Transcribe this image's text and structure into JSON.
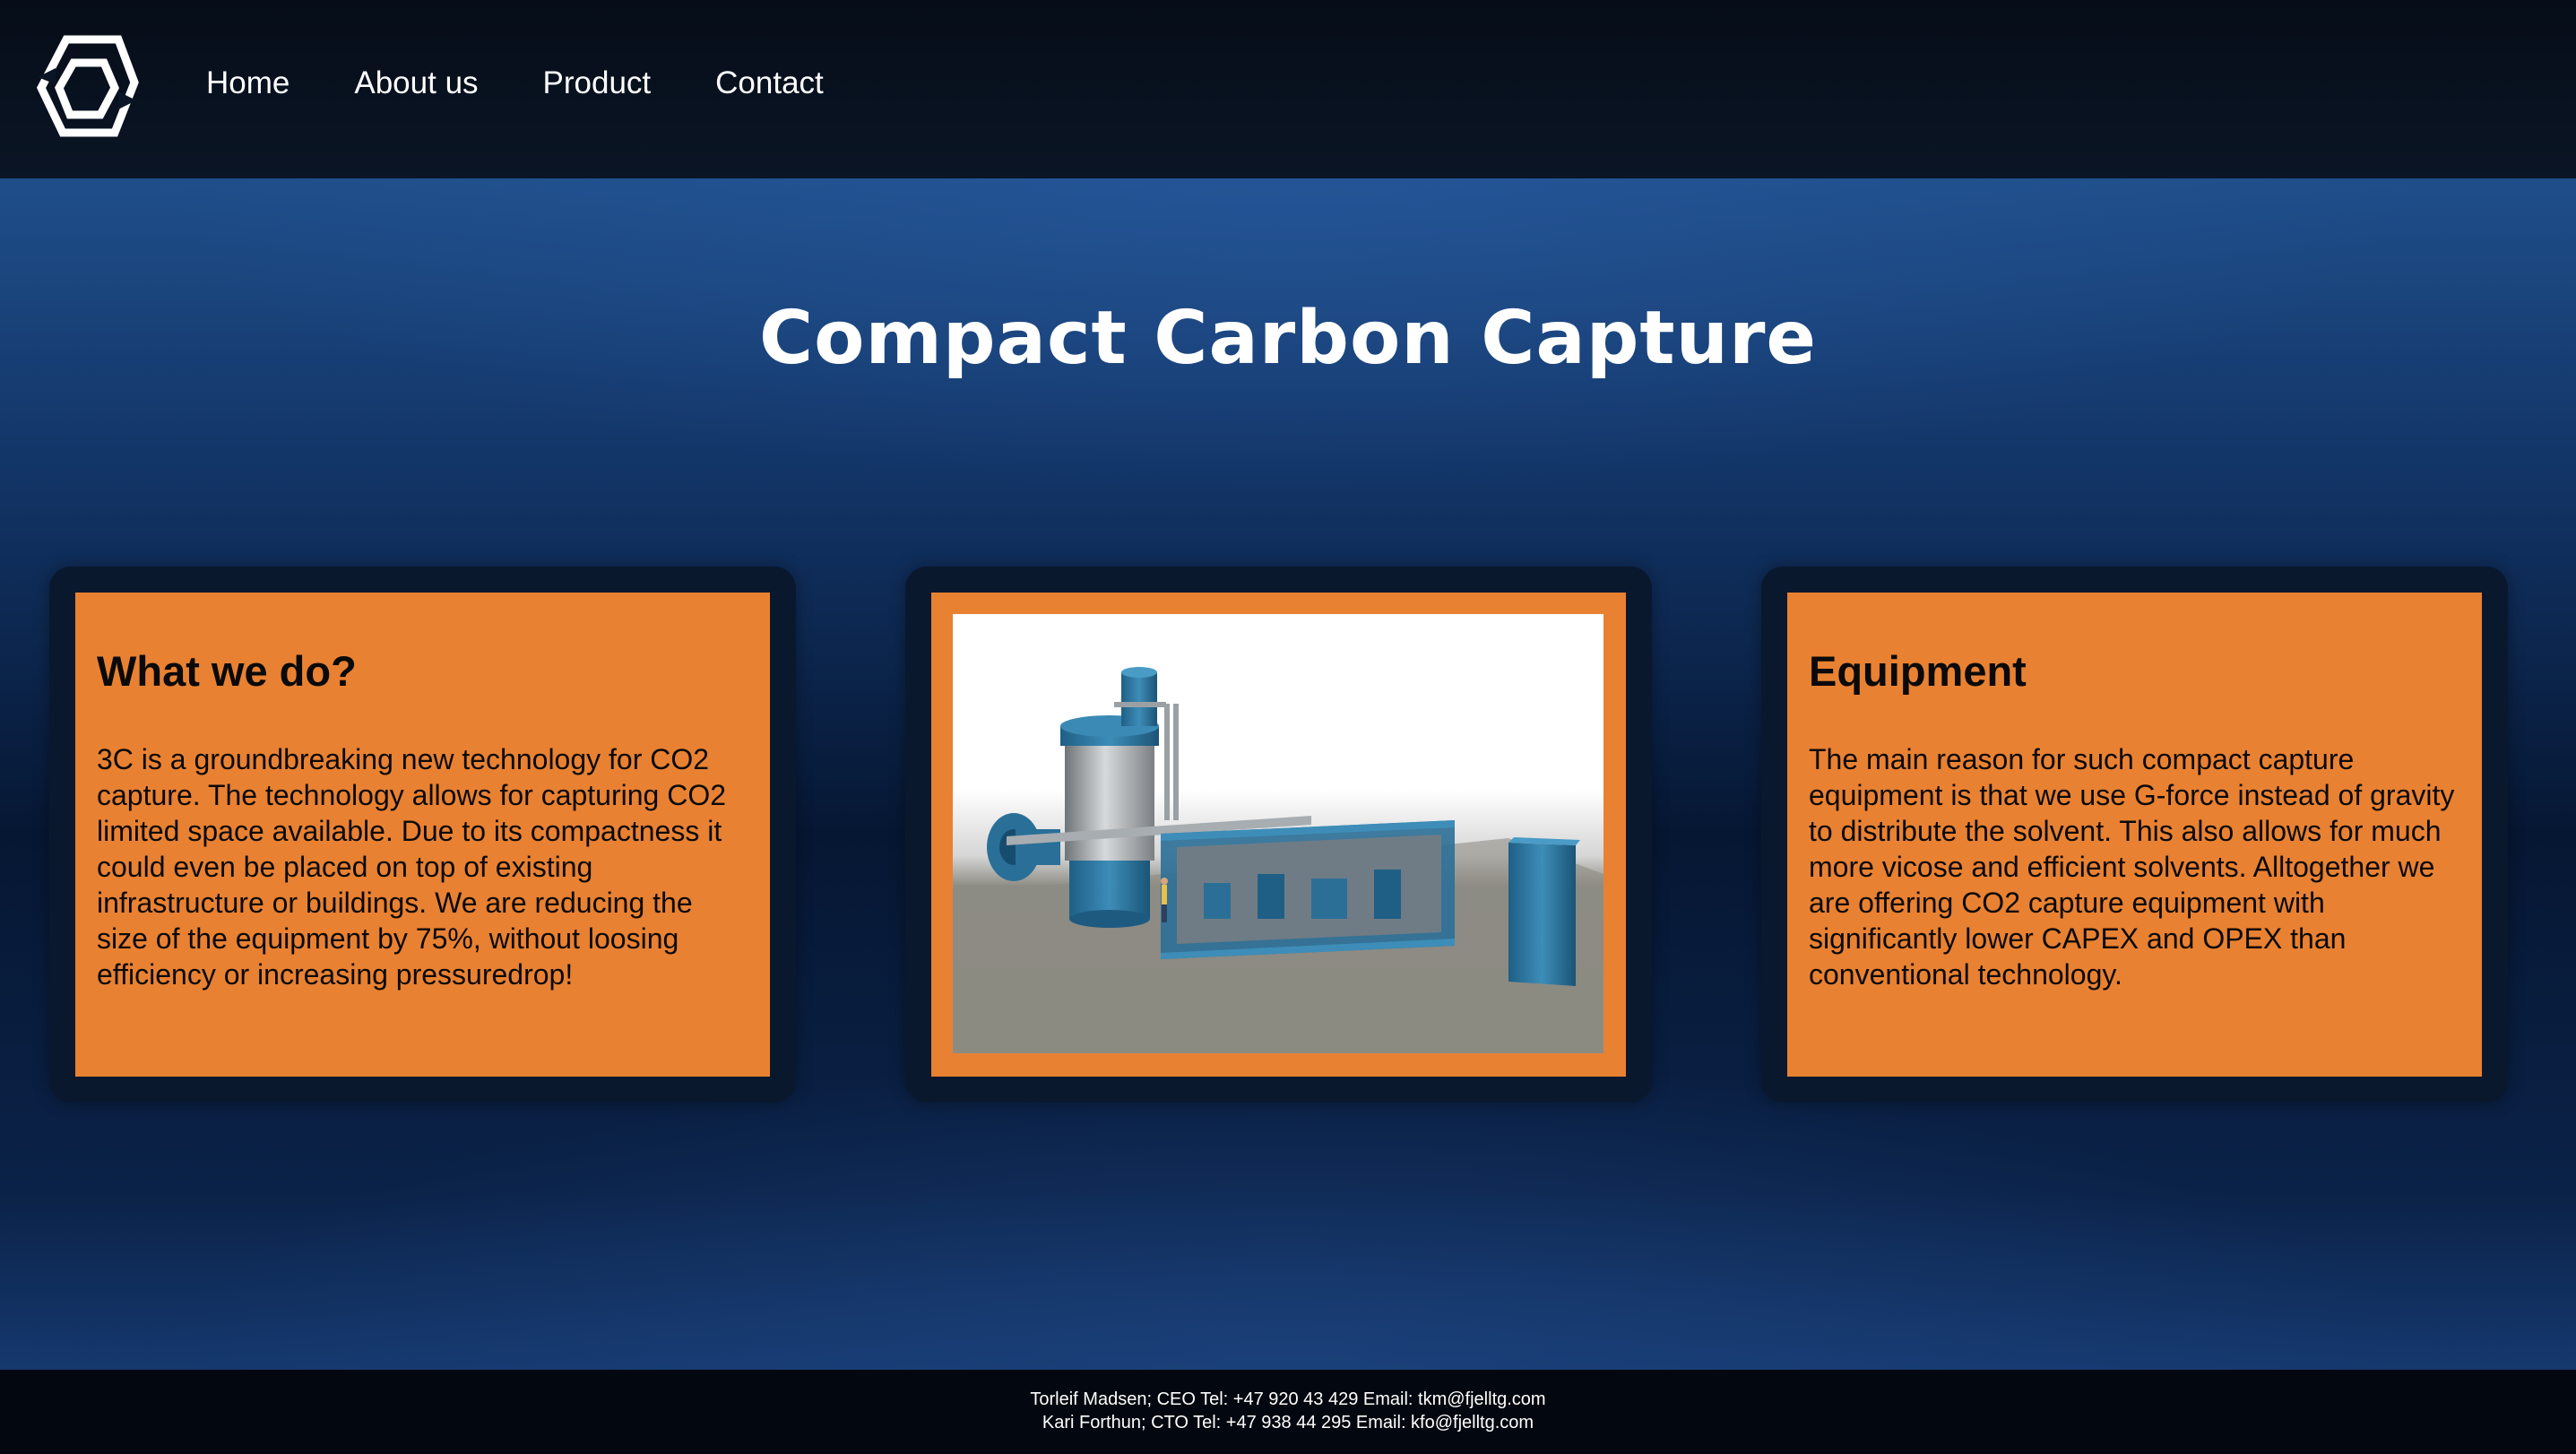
{
  "nav": {
    "logo_icon": "hexagon-logo-icon",
    "items": [
      {
        "label": "Home"
      },
      {
        "label": "About us"
      },
      {
        "label": "Product"
      },
      {
        "label": "Contact"
      }
    ]
  },
  "hero": {
    "title": "Compact Carbon Capture"
  },
  "cards": {
    "what_we_do": {
      "heading": "What we do?",
      "text": "3C is a groundbreaking new technology for CO2 capture. The technology allows for capturing CO2 limited space available. Due to its compactness it could even be placed on top of existing infrastructure or buildings. We are reducing the size of the equipment by 75%, without loosing efficiency or increasing pressuredrop!"
    },
    "image": {
      "icon": "carbon-capture-plant-image"
    },
    "equipment": {
      "heading": "Equipment",
      "text": "The main reason for such compact capture equipment is that we use G-force instead of gravity to distribute the solvent. This also allows for much more vicose and efficient solvents. Alltogether we are offering CO2 capture equipment with significantly lower CAPEX and OPEX than conventional technology."
    }
  },
  "footer": {
    "line1": "Torleif Madsen; CEO Tel: +47 920 43 429 Email: tkm@fjelltg.com",
    "line2": "Kari Forthun; CTO Tel: +47 938 44 295 Email: kfo@fjelltg.com"
  },
  "colors": {
    "nav_bg": "#060d18",
    "card_bg": "#e98132",
    "card_frame": "#0a182e",
    "hero_top": "#1f4e8a",
    "hero_mid": "#061733"
  }
}
